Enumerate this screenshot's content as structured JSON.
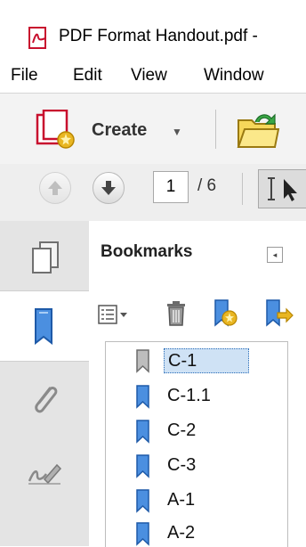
{
  "window": {
    "title": "PDF Format Handout.pdf -"
  },
  "menu": [
    "File",
    "Edit",
    "View",
    "Window"
  ],
  "toolbar": {
    "create_label": "Create"
  },
  "navigation": {
    "current_page": "1",
    "page_total": "/ 6"
  },
  "bookmarks_panel": {
    "title": "Bookmarks",
    "collapse_glyph": "◂",
    "items": [
      {
        "label": "C-1",
        "selected": true
      },
      {
        "label": "C-1.1",
        "selected": false
      },
      {
        "label": "C-2",
        "selected": false
      },
      {
        "label": "C-3",
        "selected": false
      },
      {
        "label": "A-1",
        "selected": false
      },
      {
        "label": "A-2",
        "selected": false
      }
    ]
  },
  "colors": {
    "accent_blue": "#2b6fc2",
    "selection": "#cfe2f5",
    "pdf_red": "#c8102e",
    "folder_yellow": "#e9c23d"
  },
  "icons": [
    "pdf-file-icon",
    "create-pdf-icon",
    "open-folder-icon",
    "previous-page-icon",
    "next-page-icon",
    "select-cursor-icon",
    "pages-thumbnail-icon",
    "bookmarks-rail-icon",
    "attachments-icon",
    "signatures-icon",
    "bookmark-options-icon",
    "delete-bookmark-icon",
    "new-bookmark-icon",
    "new-bookmark-from-structure-icon",
    "bookmark-icon"
  ]
}
